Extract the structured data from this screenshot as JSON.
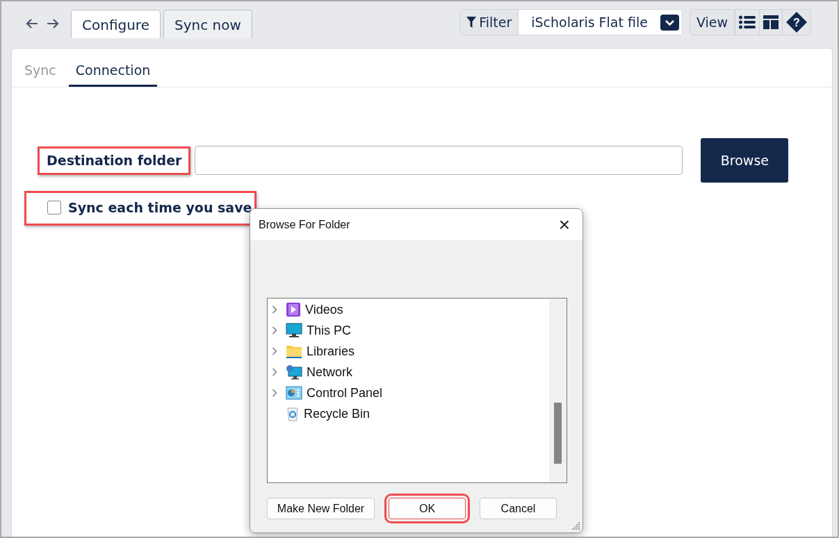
{
  "tabs": [
    {
      "label": "Configure",
      "selected": true
    },
    {
      "label": "Sync now",
      "selected": false
    }
  ],
  "filter": {
    "label": "Filter",
    "value": "iScholaris Flat file"
  },
  "view": {
    "label": "View",
    "help": "?"
  },
  "subtabs": [
    {
      "label": "Sync",
      "selected": false
    },
    {
      "label": "Connection",
      "selected": true
    }
  ],
  "destination": {
    "label": "Destination folder",
    "highlighted": true,
    "button": "Browse"
  },
  "sync_on_save": {
    "label": "Sync each time you save",
    "checked": false,
    "highlighted": true
  },
  "dialog": {
    "title": "Browse For Folder",
    "close": "×",
    "tree": [
      {
        "label": "Videos",
        "kind": "videos",
        "expandable": true
      },
      {
        "label": "This PC",
        "kind": "pc",
        "expandable": true
      },
      {
        "label": "Libraries",
        "kind": "folder",
        "expandable": true
      },
      {
        "label": "Network",
        "kind": "network",
        "expandable": true
      },
      {
        "label": "Control Panel",
        "kind": "control",
        "expandable": true
      },
      {
        "label": "Recycle Bin",
        "kind": "recycle",
        "expandable": false
      }
    ],
    "buttons": [
      {
        "label": "Make New Folder",
        "default": false,
        "highlighted": false
      },
      {
        "label": "OK",
        "default": true,
        "highlighted": true
      },
      {
        "label": "Cancel",
        "default": false,
        "highlighted": false
      }
    ]
  }
}
